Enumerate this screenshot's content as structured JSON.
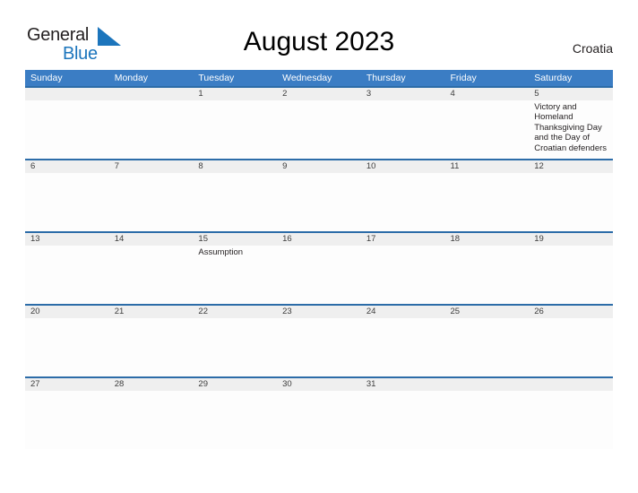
{
  "brand": {
    "name_part1": "General",
    "name_part2": "Blue",
    "flag_icon": "blue-flag-triangle",
    "color_dark": "#231f20",
    "color_blue": "#1c75bc"
  },
  "header": {
    "title": "August 2023",
    "region": "Croatia"
  },
  "theme": {
    "header_blue": "#3b7dc4",
    "divider_blue": "#2c6ca8",
    "band_gray": "#efefef",
    "cell_white": "#fdfdfd",
    "text_dark": "#231f20"
  },
  "calendar": {
    "weekdays": [
      "Sunday",
      "Monday",
      "Tuesday",
      "Wednesday",
      "Thursday",
      "Friday",
      "Saturday"
    ],
    "weeks": [
      {
        "days": [
          {
            "num": "",
            "events": []
          },
          {
            "num": "",
            "events": []
          },
          {
            "num": "1",
            "events": []
          },
          {
            "num": "2",
            "events": []
          },
          {
            "num": "3",
            "events": []
          },
          {
            "num": "4",
            "events": []
          },
          {
            "num": "5",
            "events": [
              "Victory and Homeland Thanksgiving Day and the Day of Croatian defenders"
            ]
          }
        ]
      },
      {
        "days": [
          {
            "num": "6",
            "events": []
          },
          {
            "num": "7",
            "events": []
          },
          {
            "num": "8",
            "events": []
          },
          {
            "num": "9",
            "events": []
          },
          {
            "num": "10",
            "events": []
          },
          {
            "num": "11",
            "events": []
          },
          {
            "num": "12",
            "events": []
          }
        ]
      },
      {
        "days": [
          {
            "num": "13",
            "events": []
          },
          {
            "num": "14",
            "events": []
          },
          {
            "num": "15",
            "events": [
              "Assumption"
            ]
          },
          {
            "num": "16",
            "events": []
          },
          {
            "num": "17",
            "events": []
          },
          {
            "num": "18",
            "events": []
          },
          {
            "num": "19",
            "events": []
          }
        ]
      },
      {
        "days": [
          {
            "num": "20",
            "events": []
          },
          {
            "num": "21",
            "events": []
          },
          {
            "num": "22",
            "events": []
          },
          {
            "num": "23",
            "events": []
          },
          {
            "num": "24",
            "events": []
          },
          {
            "num": "25",
            "events": []
          },
          {
            "num": "26",
            "events": []
          }
        ]
      },
      {
        "days": [
          {
            "num": "27",
            "events": []
          },
          {
            "num": "28",
            "events": []
          },
          {
            "num": "29",
            "events": []
          },
          {
            "num": "30",
            "events": []
          },
          {
            "num": "31",
            "events": []
          },
          {
            "num": "",
            "events": []
          },
          {
            "num": "",
            "events": []
          }
        ]
      }
    ]
  }
}
